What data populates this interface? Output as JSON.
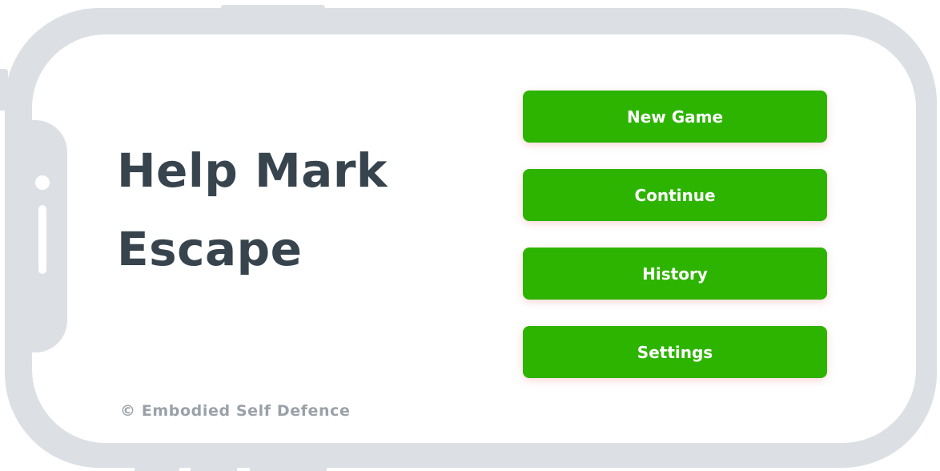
{
  "game": {
    "title_line1": "Help Mark",
    "title_line2": "Escape",
    "copyright": "© Embodied Self Defence"
  },
  "menu": {
    "new_game": "New Game",
    "continue": "Continue",
    "history": "History",
    "settings": "Settings"
  },
  "colors": {
    "button": "#2db400",
    "title": "#37444d",
    "frame": "#dcdfe3",
    "copyright": "#9aa1a8"
  }
}
